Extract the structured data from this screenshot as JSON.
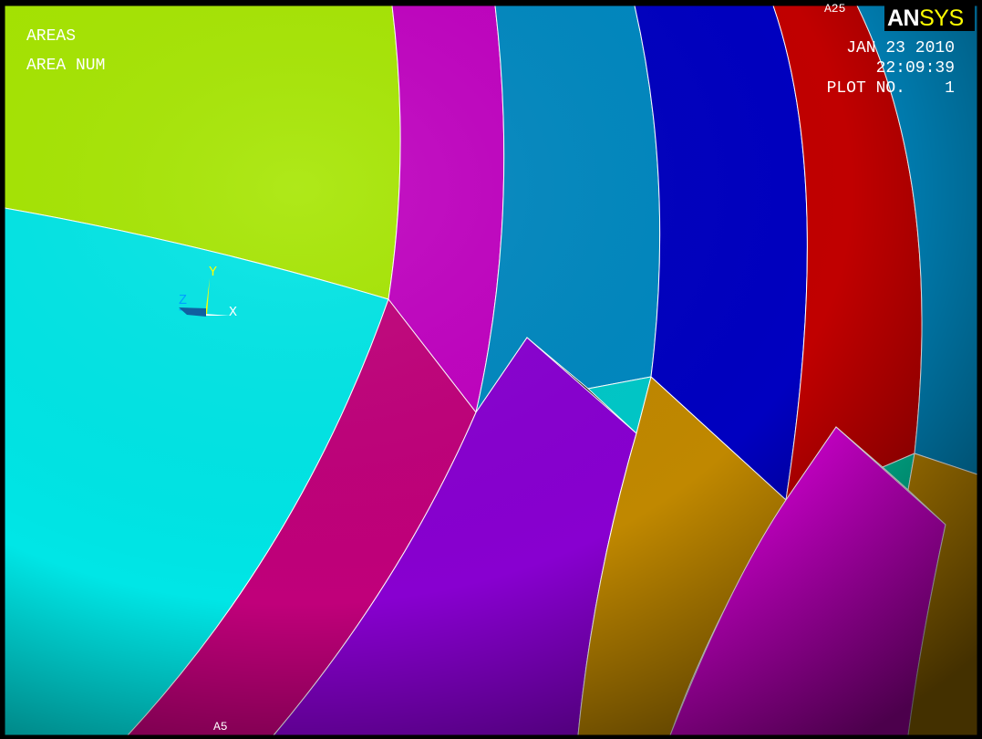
{
  "plot": {
    "title_line1": "AREAS",
    "title_line2": "AREA NUM",
    "date": "JAN 23 2010",
    "time": "22:09:39",
    "plot_no": "PLOT NO.    1"
  },
  "logo": {
    "an": "AN",
    "sys": "SYS"
  },
  "labels": {
    "top": "A25",
    "bottom": "A5"
  },
  "triad": {
    "x": "X",
    "y": "Y",
    "z": "Z"
  },
  "colors": {
    "background": "#000000",
    "lime": "#a6e600",
    "cyan": "#00e6e6",
    "magenta": "#c000c0",
    "teal_blue": "#0088c0",
    "navy": "#0000c0",
    "red": "#c00000",
    "crimson_pink": "#c0007a",
    "violet": "#8800d0",
    "orange": "#c08800",
    "pink_magenta": "#d800d8",
    "aqua_green": "#00c8a0",
    "logo_yellow": "#ffff00"
  }
}
